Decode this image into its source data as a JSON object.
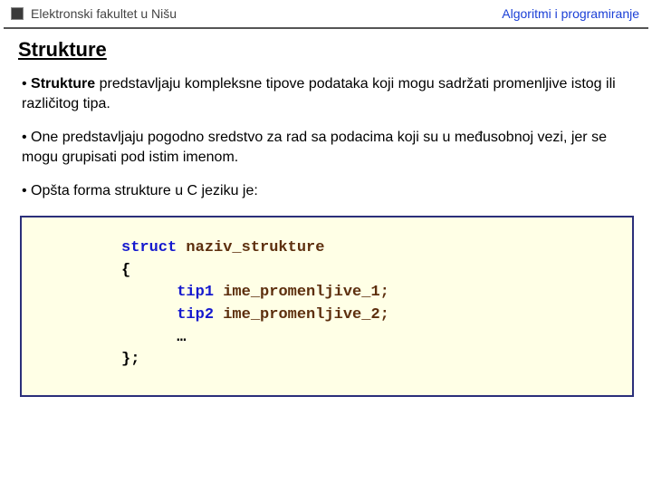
{
  "header": {
    "left": "Elektronski fakultet u Nišu",
    "right": "Algoritmi i programiranje"
  },
  "title": "Strukture",
  "para1": {
    "bullet": "• ",
    "bold": "Strukture",
    "rest": " predstavljaju kompleksne tipove podataka koji mogu sadržati promenljive istog ili različitog tipa."
  },
  "para2": "• One predstavljaju pogodno sredstvo za rad sa podacima koji su u međusobnoj vezi, jer se mogu grupisati pod istim imenom.",
  "para3": "• Opšta forma strukture u C jeziku je:",
  "code": {
    "l1_kw": "struct",
    "l1_name": " naziv_strukture",
    "l2": "{",
    "l3_type": "      tip1",
    "l3_name": " ime_promenljive_1;",
    "l4_type": "      tip2",
    "l4_name": " ime_promenljive_2;",
    "l5": "      …",
    "l6": "};"
  }
}
